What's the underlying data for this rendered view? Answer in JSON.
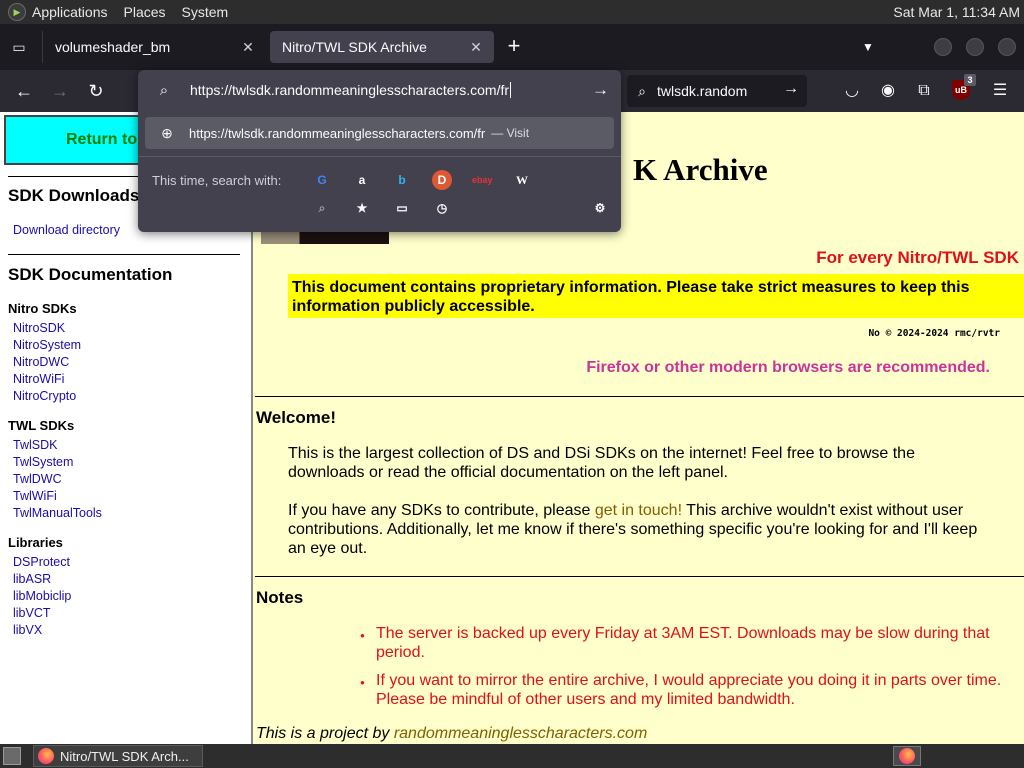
{
  "topbar": {
    "applications": "Applications",
    "places": "Places",
    "system": "System",
    "clock": "Sat Mar 1, 11:34 AM"
  },
  "tabs": [
    {
      "label": "volumeshader_bm",
      "active": false
    },
    {
      "label": "Nitro/TWL SDK Archive",
      "active": true
    }
  ],
  "navbar": {
    "search_value": "twlsdk.random"
  },
  "urlbar": {
    "typed_value": "https://twlsdk.randommeaninglesscharacters.com/fr",
    "suggestion_url": "https://twlsdk.randommeaninglesscharacters.com/fr",
    "suggestion_action": "— Visit",
    "search_with_label": "This time, search with:",
    "engines": [
      "google-icon",
      "amazon-icon",
      "bing-icon",
      "duckduckgo-icon",
      "ebay-icon",
      "wikipedia-icon"
    ],
    "engine_glyphs": {
      "google": "G",
      "amazon": "a",
      "bing": "b",
      "duckduckgo": "D",
      "ebay": "ebay",
      "wikipedia": "W"
    }
  },
  "extension_badge": "3",
  "sidebar": {
    "return_label": "Return to",
    "downloads_heading": "SDK Downloads",
    "download_directory": "Download directory",
    "documentation_heading": "SDK Documentation",
    "groups": [
      {
        "heading": "Nitro SDKs",
        "links": [
          "NitroSDK",
          "NitroSystem",
          "NitroDWC",
          "NitroWiFi",
          "NitroCrypto"
        ]
      },
      {
        "heading": "TWL SDKs",
        "links": [
          "TwlSDK",
          "TwlSystem",
          "TwlDWC",
          "TwlWiFi",
          "TwlManualTools"
        ]
      },
      {
        "heading": "Libraries",
        "links": [
          "DSProtect",
          "libASR",
          "libMobiclip",
          "libVCT",
          "libVX"
        ]
      }
    ]
  },
  "main": {
    "title_visible": "K Archive",
    "for_every": "For every Nitro/TWL SDK",
    "warning": "This document contains proprietary information. Please take strict measures to keep this information publicly accessible.",
    "copyright": "No © 2024-2024 rmc/rvtr",
    "recommend": "Firefox or other modern browsers are recommended.",
    "welcome_heading": "Welcome!",
    "welcome_p1": "This is the largest collection of DS and DSi SDKs on the internet! Feel free to browse the downloads or read the official documentation on the left panel.",
    "welcome_p2_before": "If you have any SDKs to contribute, please ",
    "welcome_p2_link": "get in touch!",
    "welcome_p2_after": " This archive wouldn't exist without user contributions. Additionally, let me know if there's something specific you're looking for and I'll keep an eye out.",
    "notes_heading": "Notes",
    "notes": [
      "The server is backed up every Friday at 3AM EST. Downloads may be slow during that period.",
      "If you want to mirror the entire archive, I would appreciate you doing it in parts over time. Please be mindful of other users and my limited bandwidth."
    ],
    "footer_before": "This is a project by ",
    "footer_link": "randommeaninglesscharacters.com"
  },
  "taskbar": {
    "window_label": "Nitro/TWL SDK Arch..."
  },
  "colors": {
    "page_bg": "#ffffcc",
    "return_bg": "#00ffff",
    "warning_bg": "#ffff00",
    "red_text": "#e0101a",
    "magenta_text": "#cc3399",
    "link": "#1a0dab"
  }
}
